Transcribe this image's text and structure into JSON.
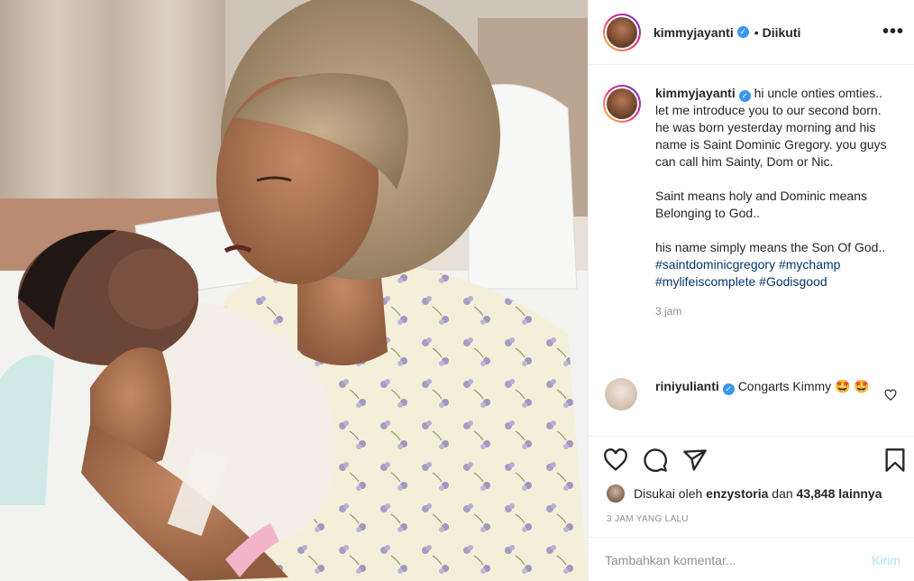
{
  "post": {
    "author": "kimmyjayanti",
    "follow_dot": "•",
    "follow_status": "Diikuti",
    "more_glyph": "•••",
    "image_alt": "Mother kissing newborn baby in hospital"
  },
  "caption": {
    "username": "kimmyjayanti",
    "text": "hi uncle onties omties.. let me introduce you to our second born. he was born yesterday morning and his name is Saint Dominic Gregory. you guys can call him Sainty, Dom or Nic.\n\nSaint means holy and Dominic means Belonging to God..\n\nhis name simply means the Son Of God..",
    "hashtags": [
      "#saintdominicgregory",
      "#mychamp",
      "#mylifeiscomplete",
      "#Godisgood"
    ],
    "time": "3 jam"
  },
  "comments": [
    {
      "username": "riniyulianti",
      "text": "Congarts Kimmy",
      "emoji": "🤩 🤩"
    }
  ],
  "likes": {
    "prefix": "Disukai oleh",
    "user": "enzystoria",
    "middle": "dan",
    "count": "43,848",
    "suffix": "lainnya"
  },
  "posted_time": "3 JAM YANG LALU",
  "add_comment": {
    "placeholder": "Tambahkan komentar...",
    "post_label": "Kirim"
  },
  "colors": {
    "link": "#00376b",
    "verified": "#3897f0",
    "post_button": "#b2dffc",
    "muted": "#8e8e8e"
  },
  "icons": [
    "verified-badge-icon",
    "more-options-icon",
    "heart-icon",
    "comment-icon",
    "share-icon",
    "bookmark-icon",
    "comment-like-heart-icon"
  ]
}
